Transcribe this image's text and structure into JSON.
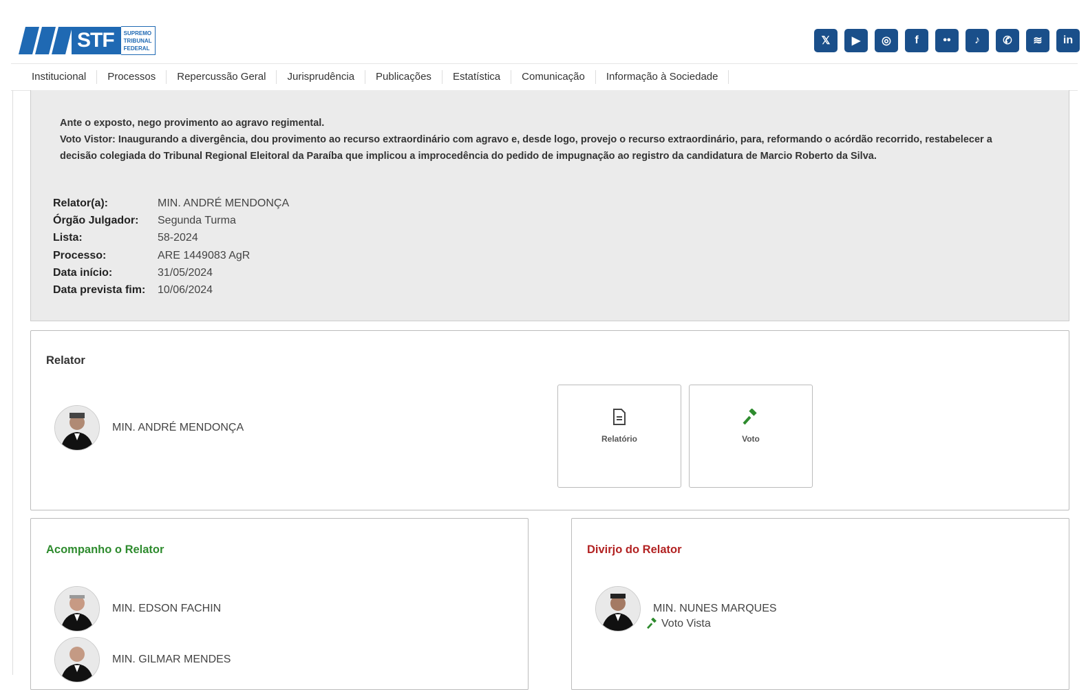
{
  "header": {
    "logo_text": "STF",
    "logo_sub": [
      "SUPREMO",
      "TRIBUNAL",
      "FEDERAL"
    ],
    "social": [
      {
        "name": "x-icon",
        "glyph": "𝕏"
      },
      {
        "name": "youtube-icon",
        "glyph": "▶"
      },
      {
        "name": "instagram-icon",
        "glyph": "◎"
      },
      {
        "name": "facebook-icon",
        "glyph": "f"
      },
      {
        "name": "flickr-icon",
        "glyph": "••"
      },
      {
        "name": "tiktok-icon",
        "glyph": "♪"
      },
      {
        "name": "whatsapp-icon",
        "glyph": "✆"
      },
      {
        "name": "spotify-icon",
        "glyph": "≋"
      },
      {
        "name": "linkedin-icon",
        "glyph": "in"
      }
    ],
    "brand_color": "#1f69b3"
  },
  "nav": {
    "items": [
      "Institucional",
      "Processos",
      "Repercussão Geral",
      "Jurisprudência",
      "Publicações",
      "Estatística",
      "Comunicação",
      "Informação à Sociedade"
    ]
  },
  "decision": {
    "line1": "Ante o exposto, nego provimento ao agravo regimental.",
    "line2": "Voto Vistor: Inaugurando a divergência, dou provimento ao recurso extraordinário com agravo e, desde logo, provejo o recurso extraordinário, para, reformando o acórdão recorrido, restabelecer a decisão colegiada do Tribunal Regional Eleitoral da Paraíba que implicou a improcedência do pedido de impugnação ao registro da candidatura de Marcio Roberto da Silva."
  },
  "meta": {
    "relator_label": "Relator(a):",
    "relator_value": "MIN. ANDRÉ MENDONÇA",
    "orgao_label": "Órgão Julgador:",
    "orgao_value": "Segunda Turma",
    "lista_label": "Lista:",
    "lista_value": "58-2024",
    "processo_label": "Processo:",
    "processo_value": "ARE 1449083 AgR",
    "inicio_label": "Data início:",
    "inicio_value": "31/05/2024",
    "fim_label": "Data prevista fim:",
    "fim_value": "10/06/2024"
  },
  "relator_card": {
    "title": "Relator",
    "minister": "MIN. ANDRÉ MENDONÇA",
    "relatorio_label": "Relatório",
    "voto_label": "Voto"
  },
  "acompanho_card": {
    "title": "Acompanho o Relator",
    "title_color": "#2e8b2e",
    "ministers": [
      "MIN. EDSON FACHIN",
      "MIN. GILMAR MENDES"
    ]
  },
  "divirjo_card": {
    "title": "Divirjo do Relator",
    "title_color": "#b22222",
    "ministers": [
      "MIN. NUNES MARQUES"
    ],
    "vote_note": "Voto Vista"
  }
}
